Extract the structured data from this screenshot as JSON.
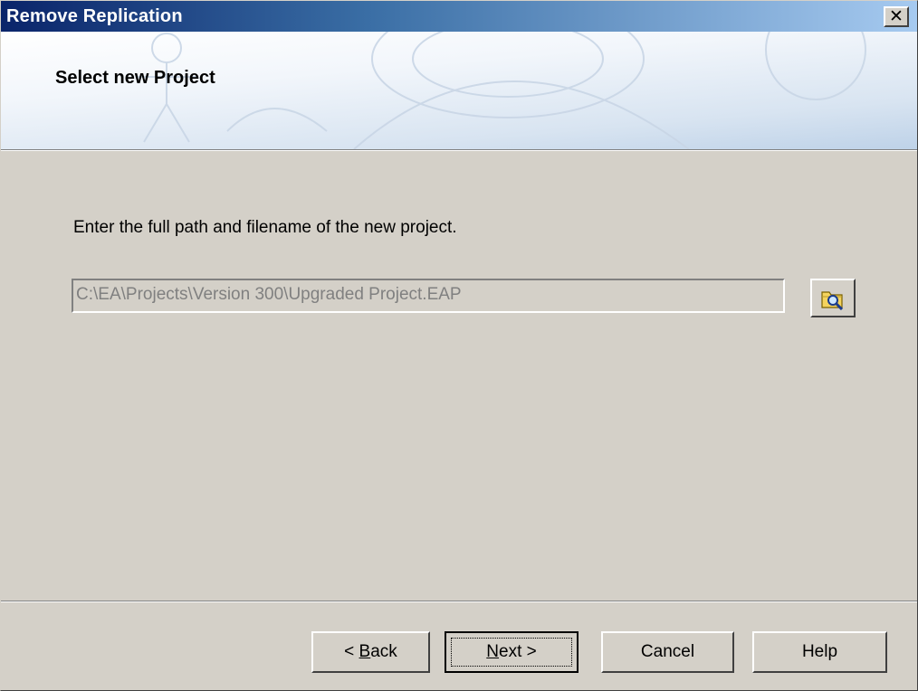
{
  "window": {
    "title": "Remove Replication"
  },
  "icons": {
    "close": "close-icon",
    "browse": "folder-search-icon"
  },
  "header": {
    "title": "Select new Project"
  },
  "main": {
    "instruction": "Enter the full path and filename of the new project.",
    "path_value": "C:\\EA\\Projects\\Version 300\\Upgraded Project.EAP"
  },
  "buttons": {
    "back": {
      "prefix": "< ",
      "mnemonic": "B",
      "rest": "ack"
    },
    "next": {
      "mnemonic": "N",
      "rest": "ext >"
    },
    "cancel": "Cancel",
    "help": "Help"
  },
  "colors": {
    "titlebar_start": "#0a246a",
    "titlebar_end": "#a6caf0",
    "face": "#d4d0c8"
  }
}
